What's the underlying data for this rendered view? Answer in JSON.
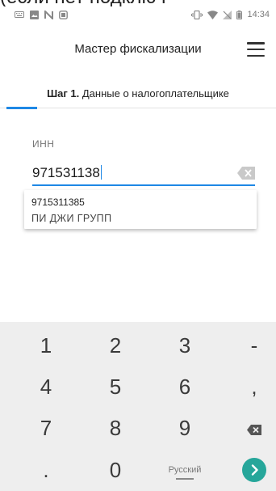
{
  "top_clip_text": "(если нет подключ",
  "status": {
    "time": "14:34",
    "left_icons": [
      "keyboard-icon",
      "image-icon",
      "n-icon",
      "screen-icon"
    ],
    "right_icons": [
      "vibrate-icon",
      "wifi-icon",
      "no-signal-icon",
      "battery-icon"
    ]
  },
  "app_bar": {
    "title": "Мастер фискализации",
    "menu_icon": "hamburger-menu-icon"
  },
  "step": {
    "prefix": "Шаг 1.",
    "title": "Данные о налогоплательщике"
  },
  "inn_field": {
    "label": "ИНН",
    "value": "971531138",
    "clear_icon": "clear-text-icon"
  },
  "suggestion": {
    "inn": "9715311385",
    "name": "ПИ ДЖИ ГРУПП"
  },
  "keyboard": {
    "rows": [
      [
        "1",
        "2",
        "3",
        "-"
      ],
      [
        "4",
        "5",
        "6",
        ","
      ],
      [
        "7",
        "8",
        "9",
        "⌫"
      ],
      [
        ".",
        "0",
        "Русский",
        "›"
      ]
    ],
    "accent": "#26a69a"
  }
}
